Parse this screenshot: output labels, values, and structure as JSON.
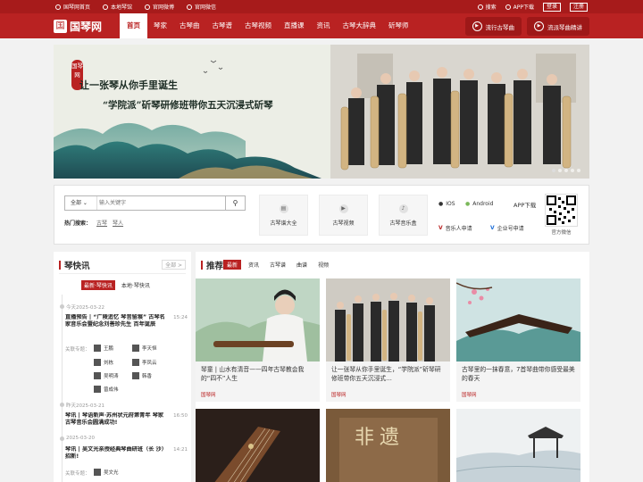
{
  "topbar": {
    "links": [
      "国琴网首页",
      "本地琴馆",
      "官网微博",
      "官网微信"
    ],
    "search": "搜索",
    "app_download": "APP下载",
    "login": "登录",
    "register": "注册"
  },
  "logo": {
    "mark": "国",
    "text": "国琴网"
  },
  "nav": {
    "items": [
      "首页",
      "琴家",
      "古琴曲",
      "古琴谱",
      "古琴视频",
      "直播课",
      "资讯",
      "古琴大辞典",
      "斫琴师"
    ],
    "active_index": 0,
    "right_buttons": [
      "流行古琴曲",
      "流派琴曲精讲"
    ]
  },
  "banner": {
    "seal": "国琴网",
    "headline1": "让一张琴从你手里诞生",
    "headline2": "“学院派”斫琴研修班带你五天沉浸式斫琴",
    "dots": 5,
    "active_dot": 0
  },
  "search": {
    "scope": "全部",
    "placeholder": "输入关键字",
    "hot_label": "热门搜索：",
    "hot_keywords": [
      "古琴",
      "琴人"
    ]
  },
  "quick_buttons": [
    {
      "label": "古琴谱大全",
      "icon": "score-icon"
    },
    {
      "label": "古琴视频",
      "icon": "video-icon"
    },
    {
      "label": "古琴音乐盒",
      "icon": "music-note-icon"
    }
  ],
  "app": {
    "ios": "IOS",
    "android": "Android",
    "download": "APP下载",
    "musician_apply": "音乐人申请",
    "enterprise_apply": "企业号申请",
    "qr_label": "官方微信"
  },
  "news": {
    "title": "琴快讯",
    "more": "全部 >",
    "tabs": [
      "最新·琴快讯",
      "本地·琴快讯"
    ],
    "active_tab": 0,
    "groups": [
      {
        "date": "今天2025-03-22",
        "title": "直播预告 | “广陵追忆 琴音留痕” 古琴名家音乐会暨纪念刘善珍先生 百年诞辰",
        "time": "15:24",
        "tag_label": "关联专题：",
        "people": [
          "王鹏",
          "李天恒",
          "刘栋",
          "李凤云",
          "吴明涛",
          "韩香",
          "曾成伟"
        ]
      },
      {
        "date": "昨天2025-03-21",
        "title": "琴讯 | 琴语新声·苏州状元府第青年 琴家古琴音乐会圆满成功!",
        "time": "16:50"
      },
      {
        "date": "2025-03-20",
        "title": "琴讯 | 吴文光亲授经典琴曲研班（长 沙）招新!",
        "time": "14:21",
        "tag_label": "关联专题：",
        "people": [
          "吴文光"
        ]
      }
    ]
  },
  "recommend": {
    "title": "推荐",
    "tabs": [
      "最新",
      "资讯",
      "古琴谱",
      "曲谱",
      "视频"
    ],
    "active_tab": 0,
    "cards": [
      {
        "title": "琴童 | 山水有清音——四年古琴教会我的“四不”人生",
        "source": "国琴网"
      },
      {
        "title": "让一张琴从你手里诞生，“学院派”斫琴研修班带你五天沉浸式…",
        "source": "国琴网"
      },
      {
        "title": "古琴里的一抹春意，7首琴曲带你感受最美的春天",
        "source": "国琴网"
      }
    ],
    "bottom_card_text": "非遗"
  },
  "colors": {
    "brand": "#b92222",
    "topbar": "#a71b1b"
  }
}
